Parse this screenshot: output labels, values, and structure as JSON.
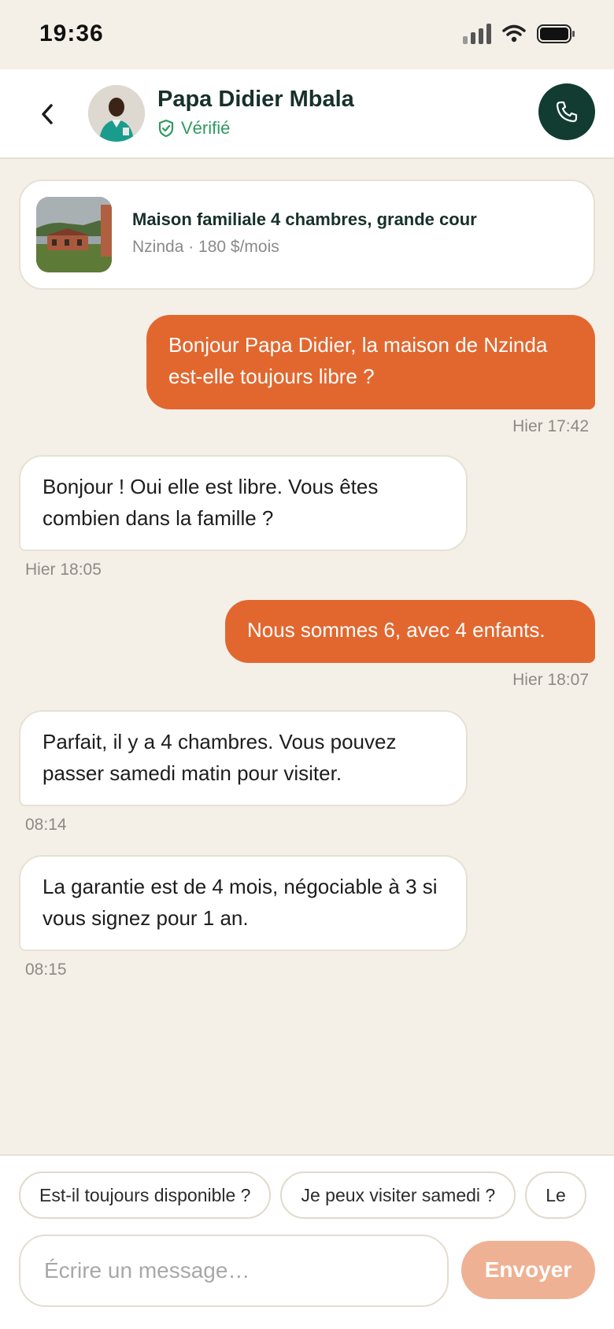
{
  "status_bar": {
    "time": "19:36"
  },
  "header": {
    "back_icon": "chevron-left-icon",
    "contact_name": "Papa Didier Mbala",
    "verified_label": "Vérifié",
    "call_icon": "phone-icon"
  },
  "listing": {
    "title": "Maison familiale 4 chambres, grande cour",
    "subtitle": "Nzinda · 180 $/mois"
  },
  "messages": [
    {
      "direction": "out",
      "text": "Bonjour Papa Didier, la maison de Nzinda est-elle toujours libre ?",
      "time": "Hier 17:42"
    },
    {
      "direction": "in",
      "text": "Bonjour ! Oui elle est libre. Vous êtes combien dans la famille ?",
      "time": "Hier 18:05"
    },
    {
      "direction": "out",
      "text": "Nous sommes 6, avec 4 enfants.",
      "time": "Hier 18:07"
    },
    {
      "direction": "in",
      "text": "Parfait, il y a 4 chambres. Vous pouvez passer samedi matin pour visiter.",
      "time": "08:14"
    },
    {
      "direction": "in",
      "text": "La garantie est de 4 mois, négociable à 3 si vous signez pour 1 an.",
      "time": "08:15"
    }
  ],
  "quick_replies": [
    "Est-il toujours disponible ?",
    "Je peux visiter samedi ?",
    "Le"
  ],
  "composer": {
    "placeholder": "Écrire un message…",
    "send_label": "Envoyer"
  },
  "colors": {
    "accent": "#e2672f",
    "brand_dark": "#123c31",
    "verified": "#2e9a62",
    "send_disabled": "#efb193",
    "background": "#f4f0e8"
  }
}
